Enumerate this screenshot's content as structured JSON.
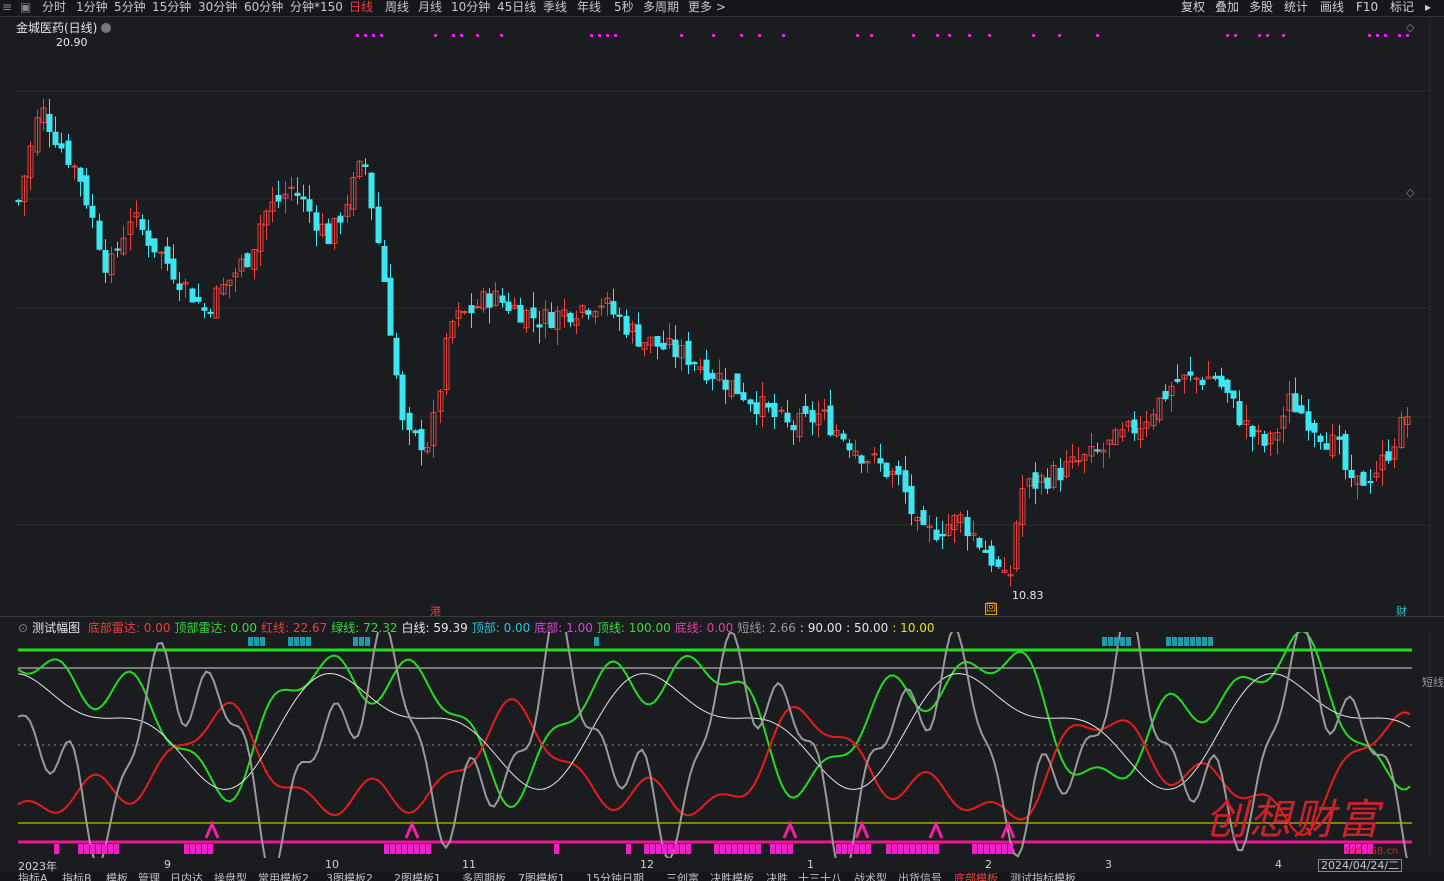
{
  "toolbar": {
    "items": [
      "分时",
      "1分钟",
      "5分钟",
      "15分钟",
      "30分钟",
      "60分钟",
      "分钟*150",
      "日线",
      "周线",
      "月线",
      "10分钟",
      "45日线",
      "季线",
      "年线",
      "5秒",
      "多周期",
      "更多 >"
    ],
    "active": "日线",
    "right": [
      "复权",
      "叠加",
      "多股",
      "统计",
      "画线",
      "F10",
      "标记"
    ]
  },
  "chart": {
    "title": "金城医药(日线)",
    "high_label": "20.90",
    "low_label": "10.83",
    "markers": {
      "hk": "港",
      "box": "回",
      "fin": "财"
    }
  },
  "indicator": {
    "name": "测试幅图",
    "items": [
      {
        "label": "底部雷达:",
        "value": "0.00",
        "color": "#e8403a"
      },
      {
        "label": "顶部雷达:",
        "value": "0.00",
        "color": "#33dd33"
      },
      {
        "label": "红线:",
        "value": "22.67",
        "color": "#e8403a"
      },
      {
        "label": "绿线:",
        "value": "72.32",
        "color": "#33dd33"
      },
      {
        "label": "白线:",
        "value": "59.39",
        "color": "#e6e6e6"
      },
      {
        "label": "顶部:",
        "value": "0.00",
        "color": "#22c4d8"
      },
      {
        "label": "底部:",
        "value": "1.00",
        "color": "#e040e0"
      },
      {
        "label": "顶线:",
        "value": "100.00",
        "color": "#33dd33"
      },
      {
        "label": "底线:",
        "value": "0.00",
        "color": "#e040a0"
      },
      {
        "label": "短线:",
        "value": "2.66",
        "color": "#999999"
      },
      {
        "label": ":",
        "value": "90.00",
        "color": "#e6e6e6"
      },
      {
        "label": ":",
        "value": "50.00",
        "color": "#e6e6e6"
      },
      {
        "label": ":",
        "value": "10.00",
        "color": "#e6e600"
      }
    ],
    "right_tag": "短线"
  },
  "xaxis": {
    "labels": [
      "2023年",
      "9",
      "10",
      "11",
      "12",
      "1",
      "2",
      "3",
      "4"
    ],
    "cursor_date": "2024/04/24/二"
  },
  "bottom_tabs": [
    "指标A",
    "指标B",
    "模板",
    "管理",
    "日内达",
    "操盘型",
    "常用模板2",
    "3图模板2",
    "2图模板1",
    "多周期板",
    "7图模板1",
    "15分钟日期",
    "三创富",
    "决胜模板",
    "决胜",
    "十三十八",
    "战术型",
    "出货信号",
    "底部模板",
    "测试指标模板"
  ],
  "watermark": {
    "text": "创想财富",
    "url": "995168.cn"
  },
  "colors": {
    "up": "#e8403a",
    "down": "#3ce6f0",
    "bg": "#1b1c20"
  }
}
